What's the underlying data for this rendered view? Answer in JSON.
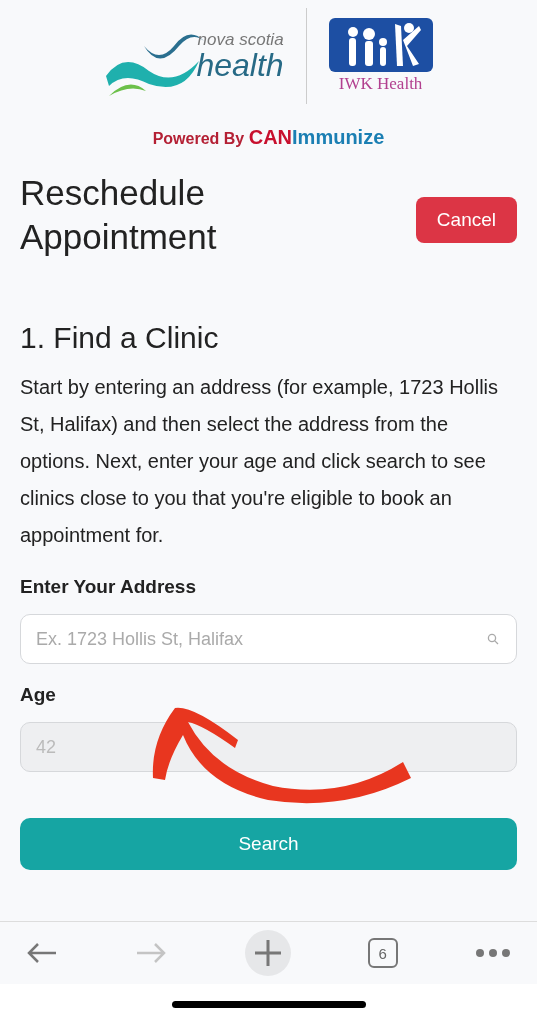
{
  "header": {
    "nsh_logo": {
      "line_1": "nova scotia",
      "line_2": "health"
    },
    "iwk_logo": {
      "label": "IWK Health"
    },
    "powered_by": {
      "prefix": "Powered By",
      "brand_1": "CAN",
      "brand_2": "Immunize"
    }
  },
  "title": "Reschedule Appointment",
  "cancel_button": "Cancel",
  "section": {
    "heading": "1. Find a Clinic",
    "intro": "Start by entering an address (for example, 1723 Hollis St, Halifax) and then select the address from the options. Next, enter your age and click search to see clinics close to you that you're eligible to book an appointment for."
  },
  "fields": [
    {
      "kind": "search",
      "label": "Enter Your Address",
      "placeholder": "Ex. 1723 Hollis St, Halifax",
      "disabled": false
    },
    {
      "kind": "text",
      "label": "Age",
      "value": "42",
      "disabled": true
    }
  ],
  "search_button": "Search",
  "annotation": {
    "kind": "arrow"
  },
  "browser_toolbar": {
    "tab_count": "6",
    "forward_disabled": true
  }
}
